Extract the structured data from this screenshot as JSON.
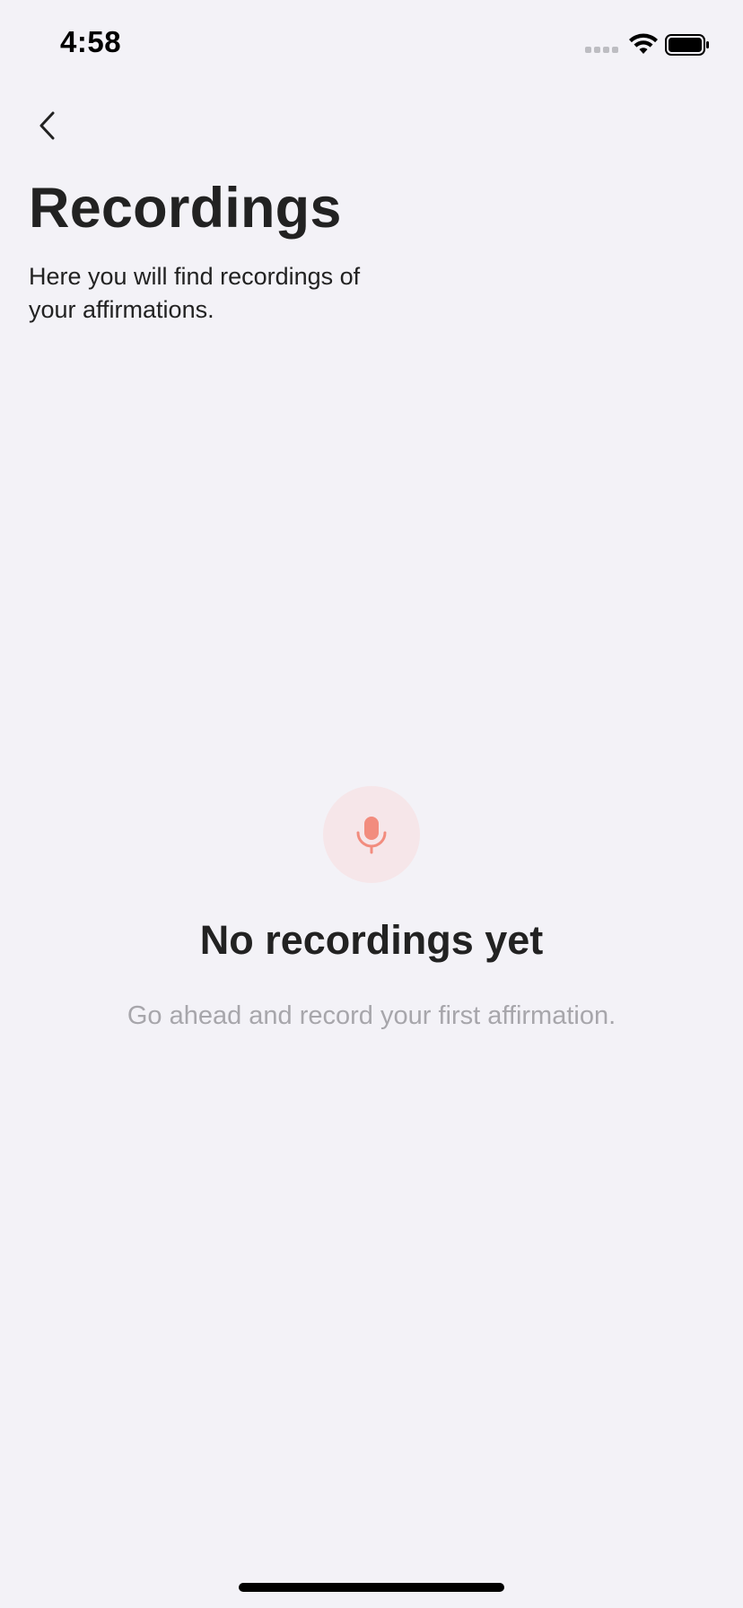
{
  "status_bar": {
    "time": "4:58"
  },
  "icons": {
    "back": "chevron-left-icon",
    "microphone": "microphone-icon",
    "wifi": "wifi-icon",
    "battery": "battery-icon",
    "signal": "signal-icon"
  },
  "header": {
    "title": "Recordings",
    "subtitle": "Here you will find recordings of your affirmations."
  },
  "empty_state": {
    "title": "No recordings yet",
    "message": "Go ahead and record your first affirmation."
  },
  "colors": {
    "background": "#f3f2f7",
    "accent": "#f28c7e",
    "accent_soft": "#f6e6e9",
    "text_primary": "#222222",
    "text_muted": "#a7a6ab"
  }
}
